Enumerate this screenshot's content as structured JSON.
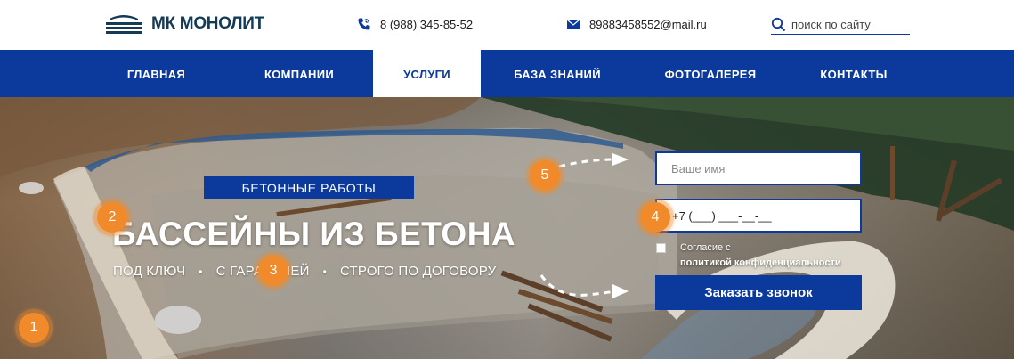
{
  "header": {
    "logo_text": "МК МОНОЛИТ",
    "phone": "8 (988) 345-85-52",
    "email": "89883458552@mail.ru",
    "search_placeholder": "поиск по сайту"
  },
  "nav": {
    "items": [
      {
        "label": "ГЛАВНАЯ"
      },
      {
        "label": "КОМПАНИИ"
      },
      {
        "label": "УСЛУГИ",
        "active": true
      },
      {
        "label": "БАЗА ЗНАНИЙ"
      },
      {
        "label": "ФОТОГАЛЕРЕЯ"
      },
      {
        "label": "КОНТАКТЫ"
      }
    ]
  },
  "hero": {
    "badge": "БЕТОННЫЕ РАБОТЫ",
    "title": "БАССЕЙНЫ ИЗ БЕТОНА",
    "features": [
      "ПОД КЛЮЧ",
      "С ГАРАНТИЕЙ",
      "СТРОГО ПО ДОГОВОРУ"
    ],
    "dot": "•"
  },
  "form": {
    "name_placeholder": "Ваше имя",
    "phone_placeholder": "+7 (___) ___-__-__",
    "consent_line1": "Согласие с",
    "consent_line2": "политикой конфиденциальности",
    "submit_label": "Заказать звонок"
  },
  "markers": [
    "1",
    "2",
    "3",
    "4",
    "5"
  ],
  "colors": {
    "brand_blue": "#0b3a9c",
    "logo_navy": "#143a55",
    "marker_orange": "#f08a2a"
  }
}
